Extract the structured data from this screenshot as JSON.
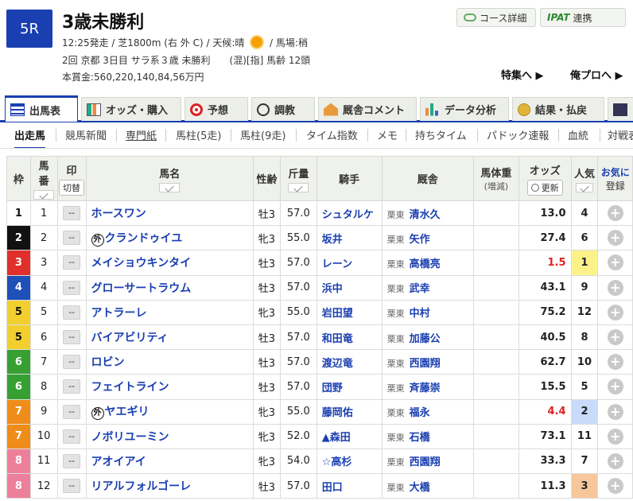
{
  "race": {
    "badge": "5R",
    "name": "3歳未勝利",
    "line1": "12:25発走 / 芝1800m (右 外 C) / 天候:晴",
    "baba": "/ 馬場:稍",
    "line2": "2回 京都 3日目 サラ系３歳 未勝利　　(混)[指] 馬齢 12頭",
    "line3": "本賞金:560,220,140,84,56万円"
  },
  "header": {
    "course_btn": "コース詳細",
    "ipat_logo": "IPAT",
    "ipat_btn": "連携",
    "tokushu": "特集へ ▶",
    "orepro": "俺プロへ ▶"
  },
  "tabs": [
    "出馬表",
    "オッズ・購入",
    "予想",
    "調教",
    "厩舎コメント",
    "データ分析",
    "結果・払戻"
  ],
  "subnav": [
    "出走馬",
    "競馬新聞",
    "専門紙",
    "馬柱(5走)",
    "馬柱(9走)",
    "タイム指数",
    "メモ",
    "持ちタイム",
    "パドック速報",
    "血統",
    "対戦表"
  ],
  "table": {
    "headers": {
      "waku": "枠",
      "umaban1": "馬",
      "umaban2": "番",
      "mark": "印",
      "switch": "切替",
      "horse": "馬名",
      "sexage": "性齢",
      "kinryo": "斤量",
      "jockey": "騎手",
      "stable": "厩舎",
      "bw1": "馬体重",
      "bw2": "(増減)",
      "odds": "オッズ",
      "update": "更新",
      "pop": "人気",
      "fav": "お気に",
      "reg": "登録"
    },
    "mark_val": "--",
    "gai": "外",
    "rows": [
      {
        "waku": "1",
        "umaban": "1",
        "horse": "ホースワン",
        "gai": false,
        "sexage": "牡3",
        "kinryo": "57.0",
        "jockey": "シュタルケ",
        "region": "栗東",
        "trainer": "清水久",
        "odds": "13.0",
        "pop": "4"
      },
      {
        "waku": "2",
        "umaban": "2",
        "horse": "クランドゥイユ",
        "gai": true,
        "sexage": "牝3",
        "kinryo": "55.0",
        "jockey": "坂井",
        "region": "栗東",
        "trainer": "矢作",
        "odds": "27.4",
        "pop": "6"
      },
      {
        "waku": "3",
        "umaban": "3",
        "horse": "メイショウキンタイ",
        "gai": false,
        "sexage": "牡3",
        "kinryo": "57.0",
        "jockey": "レーン",
        "region": "栗東",
        "trainer": "高橋亮",
        "odds": "1.5",
        "pop": "1"
      },
      {
        "waku": "4",
        "umaban": "4",
        "horse": "グローサートラウム",
        "gai": false,
        "sexage": "牡3",
        "kinryo": "57.0",
        "jockey": "浜中",
        "region": "栗東",
        "trainer": "武幸",
        "odds": "43.1",
        "pop": "9"
      },
      {
        "waku": "5",
        "umaban": "5",
        "horse": "アトラーレ",
        "gai": false,
        "sexage": "牝3",
        "kinryo": "55.0",
        "jockey": "岩田望",
        "region": "栗東",
        "trainer": "中村",
        "odds": "75.2",
        "pop": "12"
      },
      {
        "waku": "5",
        "umaban": "6",
        "horse": "バイアビリティ",
        "gai": false,
        "sexage": "牡3",
        "kinryo": "57.0",
        "jockey": "和田竜",
        "region": "栗東",
        "trainer": "加藤公",
        "odds": "40.5",
        "pop": "8"
      },
      {
        "waku": "6",
        "umaban": "7",
        "horse": "ロビン",
        "gai": false,
        "sexage": "牡3",
        "kinryo": "57.0",
        "jockey": "渡辺竜",
        "region": "栗東",
        "trainer": "西園翔",
        "odds": "62.7",
        "pop": "10"
      },
      {
        "waku": "6",
        "umaban": "8",
        "horse": "フェイトライン",
        "gai": false,
        "sexage": "牡3",
        "kinryo": "57.0",
        "jockey": "団野",
        "region": "栗東",
        "trainer": "斉藤崇",
        "odds": "15.5",
        "pop": "5"
      },
      {
        "waku": "7",
        "umaban": "9",
        "horse": "ヤエギリ",
        "gai": true,
        "sexage": "牝3",
        "kinryo": "55.0",
        "jockey": "藤岡佑",
        "region": "栗東",
        "trainer": "福永",
        "odds": "4.4",
        "pop": "2"
      },
      {
        "waku": "7",
        "umaban": "10",
        "horse": "ノボリユーミン",
        "gai": false,
        "sexage": "牝3",
        "kinryo": "52.0",
        "jockey": "▲森田",
        "region": "栗東",
        "trainer": "石橋",
        "odds": "73.1",
        "pop": "11"
      },
      {
        "waku": "8",
        "umaban": "11",
        "horse": "アオイアイ",
        "gai": false,
        "sexage": "牝3",
        "kinryo": "54.0",
        "jockey": "☆高杉",
        "region": "栗東",
        "trainer": "西園翔",
        "odds": "33.3",
        "pop": "7"
      },
      {
        "waku": "8",
        "umaban": "12",
        "horse": "リアルフォルゴーレ",
        "gai": false,
        "sexage": "牡3",
        "kinryo": "57.0",
        "jockey": "田口",
        "region": "栗東",
        "trainer": "大橋",
        "odds": "11.3",
        "pop": "3"
      }
    ]
  },
  "colors": {
    "accent": "#1a3fb0",
    "waku": {
      "1": "#ffffff",
      "2": "#111111",
      "3": "#e0302c",
      "4": "#1f50b8",
      "5": "#f2cf2e",
      "6": "#36a033",
      "7": "#f08c19",
      "8": "#ee7f9a"
    },
    "pop1": "#fdf28a",
    "pop2": "#c9dbfa",
    "pop3": "#f6c79a"
  }
}
